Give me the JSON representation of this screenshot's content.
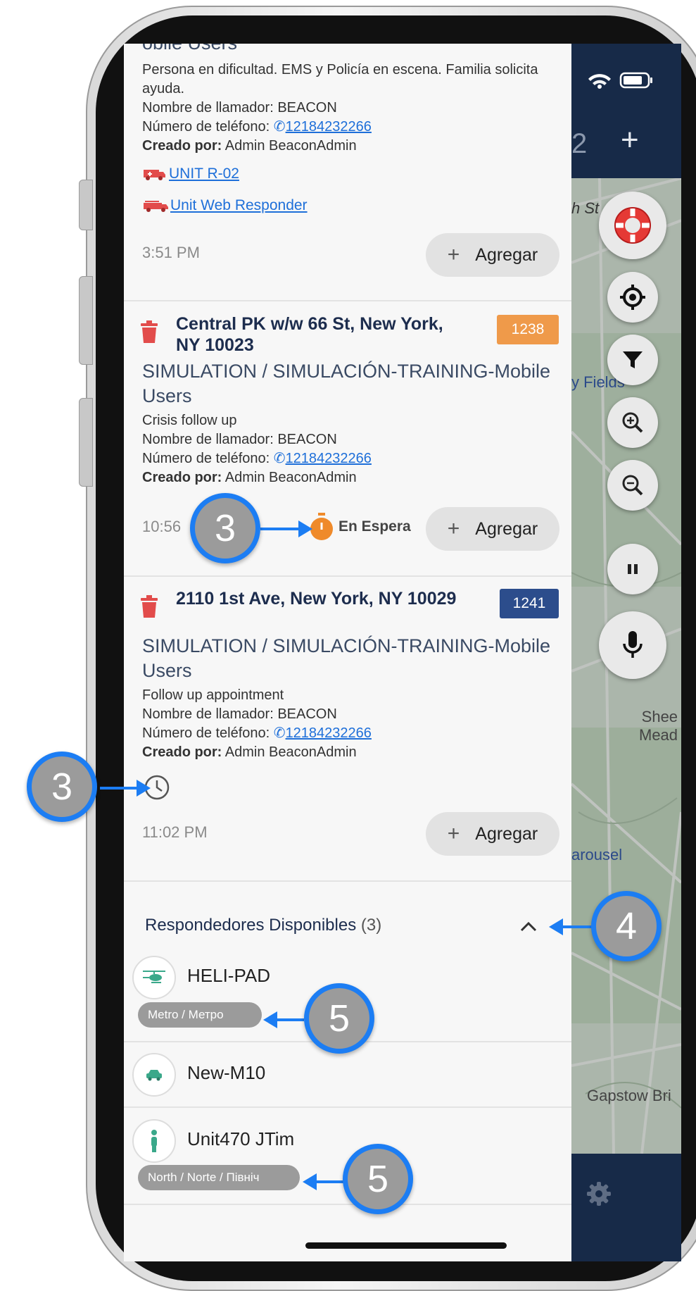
{
  "status_bar": {
    "signal": "wifi",
    "battery": "battery-icon"
  },
  "map_header": {
    "partial_count": "2",
    "add_label": "+"
  },
  "map_labels": {
    "street": "h St",
    "fields": "y Fields",
    "sheep": "Shee\nMead",
    "carousel": "arousel",
    "gapstow": "Gapstow Bri"
  },
  "incidents": [
    {
      "type_partial": "obile Users",
      "description": "Persona en dificultad. EMS y Policía en escena. Familia solicita ayuda.",
      "caller_label": "Nombre de llamador:",
      "caller": "BEACON",
      "phone_label": "Número de teléfono:",
      "phone": "12184232266",
      "creator_label": "Creado por:",
      "creator": "Admin BeaconAdmin",
      "units": [
        "UNIT R-02",
        "Unit Web Responder"
      ],
      "time": "3:51 PM",
      "add_label": "Agregar"
    },
    {
      "address": "Central PK w/w 66 St, New York, NY 10023",
      "badge": "1238",
      "type": "SIMULATION / SIMULACIÓN-TRAINING-Mobile Users",
      "description": "Crisis follow up",
      "caller_label": "Nombre de llamador:",
      "caller": "BEACON",
      "phone_label": "Número de teléfono:",
      "phone": "12184232266",
      "creator_label": "Creado por:",
      "creator": "Admin BeaconAdmin",
      "time": "10:56",
      "status": "En Espera",
      "add_label": "Agregar"
    },
    {
      "address": "2110 1st Ave, New York, NY 10029",
      "badge": "1241",
      "type": "SIMULATION / SIMULACIÓN-TRAINING-Mobile Users",
      "description": "Follow up appointment",
      "caller_label": "Nombre de llamador:",
      "caller": "BEACON",
      "phone_label": "Número de teléfono:",
      "phone": "12184232266",
      "creator_label": "Creado por:",
      "creator": "Admin BeaconAdmin",
      "time": "11:02 PM",
      "add_label": "Agregar"
    }
  ],
  "responders": {
    "title": "Respondedores Disponibles",
    "count": "(3)",
    "items": [
      {
        "name": "HELI-PAD",
        "icon": "helicopter-icon",
        "tag": "Metro / Метро"
      },
      {
        "name": "New-M10",
        "icon": "car-icon",
        "tag": ""
      },
      {
        "name": "Unit470 JTim",
        "icon": "person-icon",
        "tag": "North / Norte / Північ"
      }
    ]
  },
  "callouts": {
    "c1": "3",
    "c2": "3",
    "c3": "4",
    "c4": "5",
    "c5": "5"
  },
  "colors": {
    "accent": "#1c7df3",
    "badge_orange": "#ef9a4a",
    "badge_blue": "#2c4d8c",
    "trash_red": "#e24c4b",
    "header_navy": "#172a48"
  }
}
